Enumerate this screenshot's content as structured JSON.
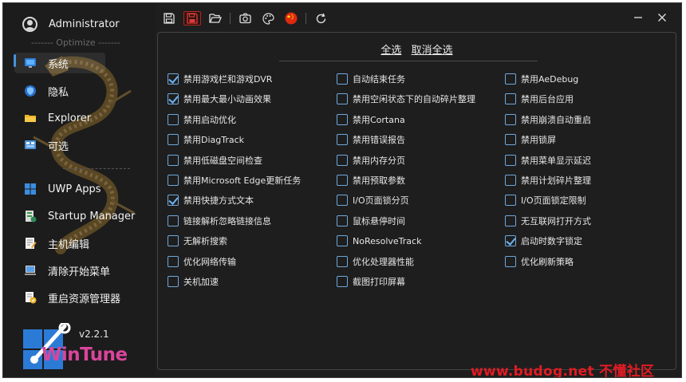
{
  "user": {
    "name": "Administrator"
  },
  "sidebar": {
    "group_label": "------- Optimize -------",
    "items": [
      {
        "label": "系统",
        "icon": "monitor-icon"
      },
      {
        "label": "隐私",
        "icon": "privacy-shield-icon"
      },
      {
        "label": "Explorer",
        "icon": "folder-icon"
      },
      {
        "label": "可选",
        "icon": "optional-settings-icon"
      },
      {
        "label": "UWP Apps",
        "icon": "windows-apps-icon"
      },
      {
        "label": "Startup Manager",
        "icon": "startup-icon"
      },
      {
        "label": "主机编辑",
        "icon": "hosts-edit-icon"
      },
      {
        "label": "清除开始菜单",
        "icon": "start-menu-clean-icon"
      },
      {
        "label": "重启资源管理器",
        "icon": "restart-explorer-icon"
      }
    ],
    "version": "v2.2.1",
    "logo_text": "WinTune"
  },
  "toolbar": {
    "buttons": [
      "save-icon",
      "save-as-icon",
      "open-folder-icon",
      "screenshot-icon",
      "theme-palette-icon",
      "language-cn-flag-icon",
      "refresh-icon"
    ]
  },
  "panel": {
    "select_all": "全选",
    "deselect_all": "取消全选",
    "options": [
      {
        "label": "禁用游戏栏和游戏DVR",
        "checked": true
      },
      {
        "label": "禁用最大最小动画效果",
        "checked": true
      },
      {
        "label": "禁用启动优化",
        "checked": false
      },
      {
        "label": "禁用DiagTrack",
        "checked": false
      },
      {
        "label": "禁用低磁盘空间检查",
        "checked": false
      },
      {
        "label": "禁用Microsoft Edge更新任务",
        "checked": false
      },
      {
        "label": "禁用快捷方式文本",
        "checked": true
      },
      {
        "label": "链接解析忽略链接信息",
        "checked": false
      },
      {
        "label": "无解析搜索",
        "checked": false
      },
      {
        "label": "优化网络传输",
        "checked": false
      },
      {
        "label": "关机加速",
        "checked": false
      },
      {
        "label": "自动结束任务",
        "checked": false
      },
      {
        "label": "禁用空闲状态下的自动碎片整理",
        "checked": false
      },
      {
        "label": "禁用Cortana",
        "checked": false
      },
      {
        "label": "禁用错误报告",
        "checked": false
      },
      {
        "label": "禁用内存分页",
        "checked": false
      },
      {
        "label": "禁用预取参数",
        "checked": false
      },
      {
        "label": "I/O页面锁分页",
        "checked": false
      },
      {
        "label": "鼠标悬停时间",
        "checked": false
      },
      {
        "label": "NoResolveTrack",
        "checked": false
      },
      {
        "label": "优化处理器性能",
        "checked": false
      },
      {
        "label": "截图打印屏幕",
        "checked": false
      },
      {
        "label": "禁用AeDebug",
        "checked": false
      },
      {
        "label": "禁用后台应用",
        "checked": false
      },
      {
        "label": "禁用崩溃自动重启",
        "checked": false
      },
      {
        "label": "禁用锁屏",
        "checked": false
      },
      {
        "label": "禁用菜单显示延迟",
        "checked": false
      },
      {
        "label": "禁用计划碎片整理",
        "checked": false
      },
      {
        "label": "I/O页面锁定限制",
        "checked": false
      },
      {
        "label": "无互联网打开方式",
        "checked": false
      },
      {
        "label": "启动时数字锁定",
        "checked": true
      },
      {
        "label": "优化刷新策略",
        "checked": false
      }
    ]
  },
  "watermark": "www.budog.net 不懂社区",
  "colors": {
    "accent": "#6fb3f2",
    "background": "#1e1e1e",
    "watermark": "#e21b23",
    "logo": "#d9459b"
  }
}
